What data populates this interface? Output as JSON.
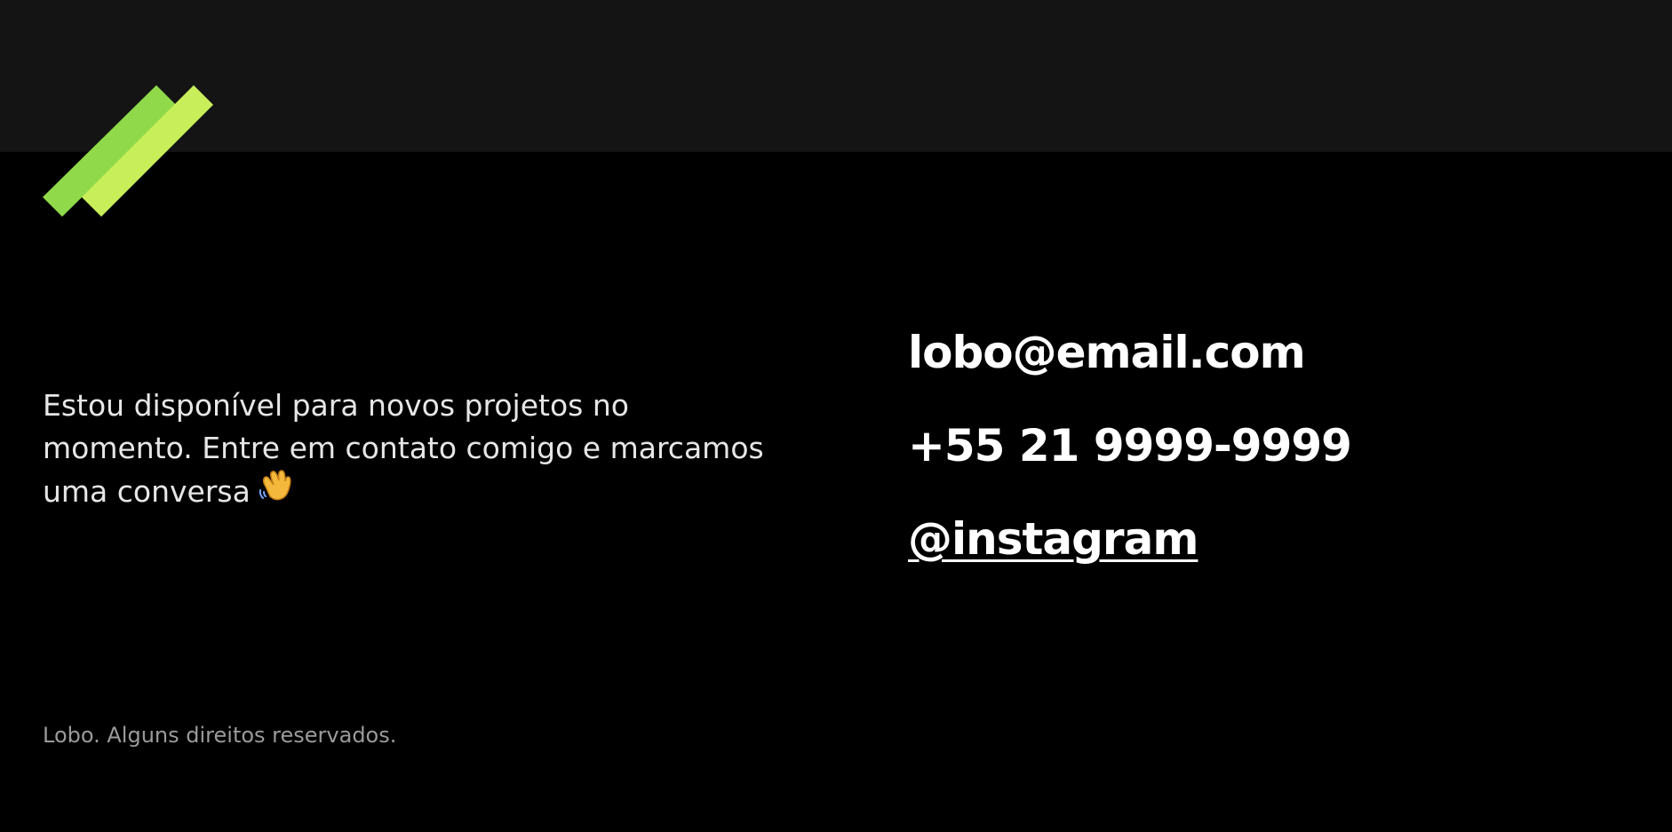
{
  "brand": {
    "logo_icon": "twin-diagonal-stripes-logo-icon",
    "colors": {
      "stripe_primary": "#8fd94a",
      "stripe_secondary": "#c8ee5a",
      "top_band": "#141414",
      "background": "#000000"
    }
  },
  "intro": {
    "lines": [
      "Estou disponível para novos projetos no",
      "momento. Entre em contato comigo e marcamos",
      "uma conversa"
    ],
    "icon": "waving-hand-icon"
  },
  "contact": {
    "email": "lobo@email.com",
    "phone": "+55 21 9999-9999",
    "instagram": "@instagram"
  },
  "footer": {
    "copyright": "Lobo. Alguns direitos reservados."
  }
}
